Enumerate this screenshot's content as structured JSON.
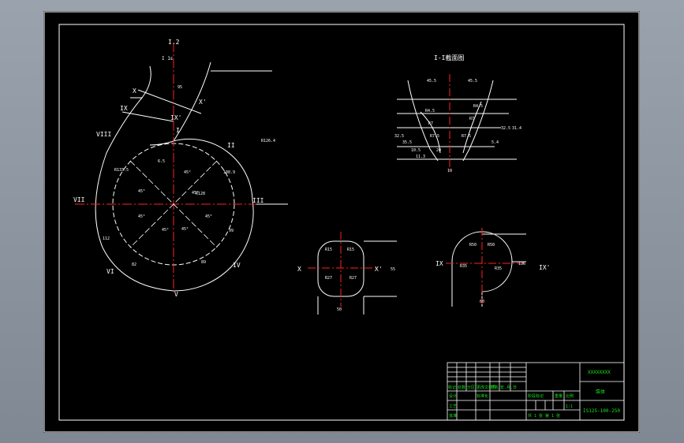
{
  "colors": {
    "background": "#000000",
    "outer_bg": "#8e97a1",
    "line": "#ffffff",
    "centerline": "#ff2020",
    "title_text": "#19e619"
  },
  "main_view": {
    "section_mark_top": "I.2",
    "section_note_top": "I 1ε",
    "labels": {
      "I": "I",
      "II": "II",
      "III": "III",
      "IV": "IV",
      "V": "V",
      "VI": "VI",
      "VII": "VII",
      "VIII": "VIII",
      "IX": "IX",
      "X": "X",
      "IXp": "IX'",
      "Xp": "X'"
    },
    "dims": {
      "r_inner": "R128",
      "d1": "R133.5",
      "d2": "6.5",
      "d3": "108.9",
      "d4": "R126.4",
      "d5": "99",
      "d6": "89",
      "d7": "112",
      "d8": "82",
      "d9": "95",
      "ang1": "45°",
      "ang2": "45°",
      "ang3": "45°",
      "ang4": "45°",
      "ang5": "45°",
      "ang6": "45°",
      "ang7": "45°"
    }
  },
  "section_I": {
    "title": "I-I截面图",
    "dims": [
      "45.5",
      "45.5",
      "R4.5",
      "R4.5",
      "R7",
      "R7",
      "R7.5",
      "R7.5",
      "32.5",
      "35.5",
      "32.5",
      "31.4",
      "10.5",
      "5.4",
      "20",
      "11.3",
      "19"
    ]
  },
  "section_X": {
    "label_left": "X",
    "label_right": "X'",
    "dims": [
      "R15",
      "R15",
      "R27",
      "R27",
      "50",
      "55"
    ]
  },
  "section_IX": {
    "label_left": "IX",
    "label_right": "IX'",
    "dims": [
      "R50",
      "R50",
      "R35",
      "R35",
      "136",
      "60"
    ]
  },
  "title_block": {
    "company": "XXXXXXXX",
    "drawing_name": "泵体",
    "drawing_number": "IS125-100-250",
    "rows": [
      "标记",
      "处数",
      "分区",
      "更改文件号",
      "签名",
      "年.月.日"
    ],
    "design": "设计",
    "standard": "标准化",
    "process": "工艺",
    "approve": "批准",
    "stage": "阶段标记",
    "weight": "重量",
    "scale": "比例",
    "scale_value": "1:1",
    "sheet": "共 1 张 第 1 张"
  }
}
